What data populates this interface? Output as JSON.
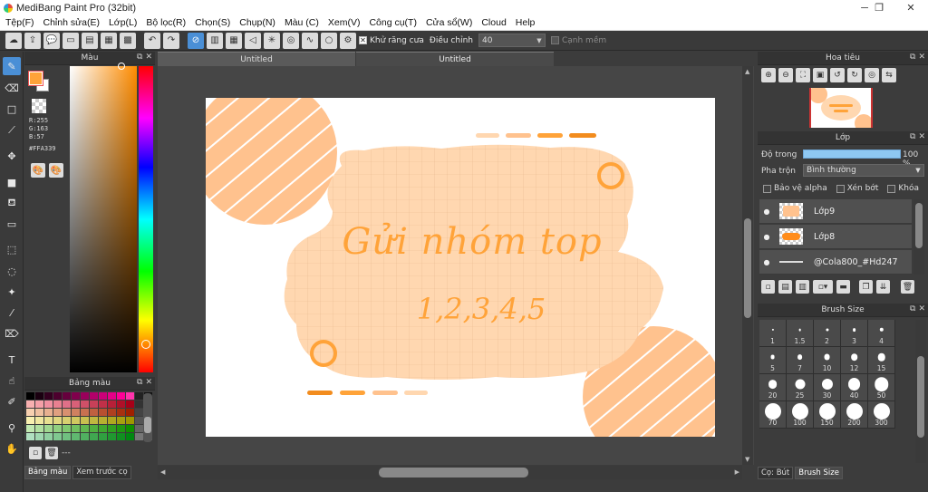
{
  "window": {
    "title": "MediBang Paint Pro (32bit)",
    "controls": [
      "─",
      "❐",
      "✕"
    ]
  },
  "menu": [
    "Tệp(F)",
    "Chỉnh sửa(E)",
    "Lớp(L)",
    "Bộ lọc(R)",
    "Chọn(S)",
    "Chụp(N)",
    "Màu (C)",
    "Xem(V)",
    "Công cụ(T)",
    "Cửa sổ(W)",
    "Cloud",
    "Help"
  ],
  "toolbar": {
    "antialias_label": "Khử răng cưa",
    "adjust_label": "Điều chỉnh",
    "adjust_value": "40",
    "edge_label": "Cạnh mềm"
  },
  "color_panel": {
    "title": "Màu",
    "r": "R:255",
    "g": "G:163",
    "b": "B:57",
    "hex": "#FFA339",
    "fg_color": "#FFA339"
  },
  "palette_panel": {
    "title": "Bảng màu",
    "footer_text": "---"
  },
  "left_tabs": [
    "Bảng màu",
    "Xem trước cọ"
  ],
  "document_tabs": [
    "Untitled",
    "Untitled"
  ],
  "artwork": {
    "headline": "Gửi nhóm top",
    "subline": "1,2,3,4,5",
    "accent": "#FFA339",
    "pale": "#FFD7B0",
    "peach": "#FFC28E"
  },
  "navigator": {
    "title": "Hoa tiêu"
  },
  "layer_panel": {
    "title": "Lớp",
    "opacity_label": "Độ trong",
    "opacity_value": "100 %",
    "opacity": 100,
    "blend_label": "Pha trộn",
    "blend_value": "Bình thường",
    "protect_alpha": "Bảo vệ alpha",
    "clipping": "Xén bớt",
    "lock": "Khóa",
    "layers": [
      {
        "name": "Lớp9"
      },
      {
        "name": "Lớp8"
      },
      {
        "name": "@Cola800_#Hd247"
      }
    ]
  },
  "brush_size_panel": {
    "title": "Brush Size",
    "sizes": [
      "1",
      "1.5",
      "2",
      "3",
      "4",
      "5",
      "7",
      "10",
      "12",
      "15",
      "20",
      "25",
      "30",
      "40",
      "50",
      "70",
      "100",
      "150",
      "200",
      "300"
    ]
  },
  "right_tabs": [
    "Cọ: Bút",
    "Brush Size"
  ]
}
